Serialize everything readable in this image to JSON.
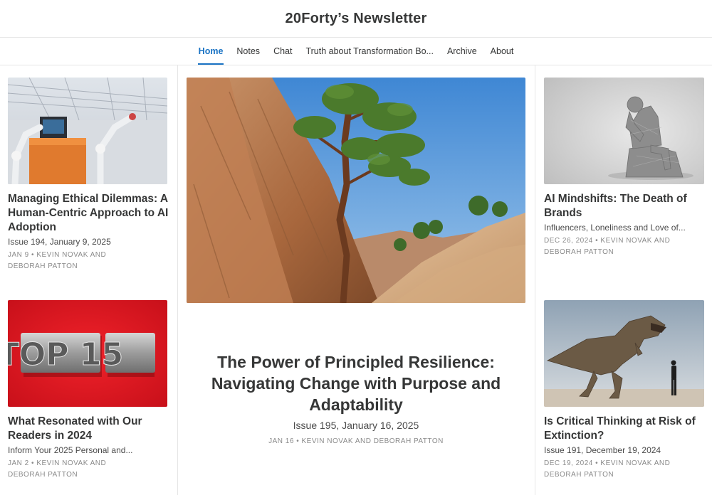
{
  "site": {
    "title": "20Forty’s Newsletter"
  },
  "nav": {
    "items": [
      {
        "label": "Home",
        "active": true
      },
      {
        "label": "Notes"
      },
      {
        "label": "Chat"
      },
      {
        "label": "Truth about Transformation Bo..."
      },
      {
        "label": "Archive"
      },
      {
        "label": "About"
      }
    ]
  },
  "posts": {
    "ethical": {
      "image": "factory-robot-arms-image",
      "title": "Managing Ethical Dilemmas: A Human-Centric Approach to AI Adoption",
      "subtitle": "Issue 194, January 9, 2025",
      "date": "JAN 9",
      "author1": "KEVIN NOVAK",
      "and": "AND",
      "author2": "DEBORAH PATTON"
    },
    "top15": {
      "image": "top-15-letterpress-image",
      "image_text": "TOP 15",
      "title": "What Resonated with Our Readers in 2024",
      "subtitle": "Inform Your 2025 Personal and...",
      "date": "JAN 2",
      "author1": "KEVIN NOVAK",
      "and": "AND",
      "author2": "DEBORAH PATTON"
    },
    "hero": {
      "image": "desert-tree-rocks-image",
      "title": "The Power of Principled Resilience: Navigating Change with Purpose and Adaptability",
      "subtitle": "Issue 195, January 16, 2025",
      "date": "JAN 16",
      "author1": "KEVIN NOVAK",
      "and": "AND",
      "author2": "DEBORAH PATTON"
    },
    "mindshifts": {
      "image": "thinker-statue-image",
      "title": "AI Mindshifts: The Death of Brands",
      "subtitle": "Influencers, Loneliness and Love of...",
      "date": "DEC 26, 2024",
      "author1": "KEVIN NOVAK",
      "and": "AND",
      "author2": "DEBORAH PATTON"
    },
    "critical": {
      "image": "dinosaur-and-man-image",
      "title": "Is Critical Thinking at Risk of Extinction?",
      "subtitle": "Issue 191, December 19, 2024",
      "date": "DEC 19, 2024",
      "author1": "KEVIN NOVAK",
      "and": "AND",
      "author2": "DEBORAH PATTON"
    }
  },
  "meta_separator": "•",
  "colors": {
    "accent": "#1a73c4",
    "text": "#363737",
    "muted": "#8a8a8a",
    "border": "#e6e6e6"
  }
}
